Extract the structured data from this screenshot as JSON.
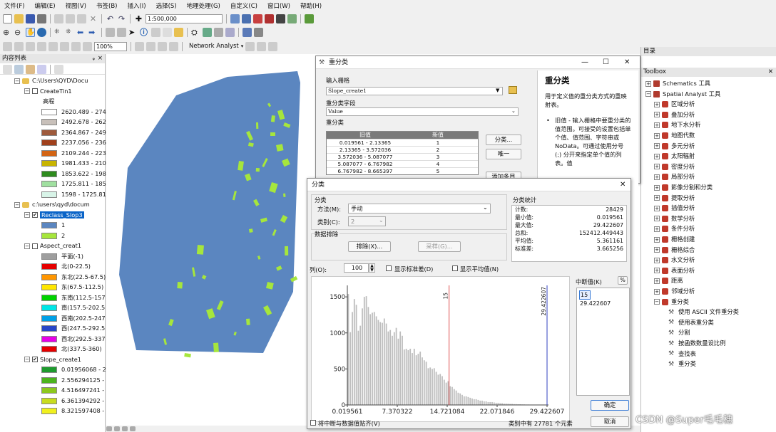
{
  "menu": [
    "文件(F)",
    "编辑(E)",
    "视图(V)",
    "书签(B)",
    "插入(I)",
    "选择(S)",
    "地理处理(G)",
    "自定义(C)",
    "窗口(W)",
    "帮助(H)"
  ],
  "toolbar": {
    "scale": "1:500,000",
    "zoom_pct": "100%",
    "network_analyst": "Network Analyst"
  },
  "toc": {
    "title": "内容列表",
    "pin": "ᵩ",
    "close": "×",
    "items": [
      {
        "type": "group",
        "label": "C:\\Users\\QYD\\Docu"
      },
      {
        "type": "layer",
        "label": "CreateTin1",
        "checked": false
      },
      {
        "type": "legend-head",
        "label": "高程"
      },
      {
        "type": "legend",
        "label": "2620.489 - 274",
        "color": "#fff"
      },
      {
        "type": "legend",
        "label": "2492.678 - 262",
        "color": "#c8c0ba"
      },
      {
        "type": "legend",
        "label": "2364.867 - 249",
        "color": "#9e5a3c"
      },
      {
        "type": "legend",
        "label": "2237.056 - 236",
        "color": "#a0401c"
      },
      {
        "type": "legend",
        "label": "2109.244 - 223",
        "color": "#d26414"
      },
      {
        "type": "legend",
        "label": "1981.433 - 210",
        "color": "#c8b400"
      },
      {
        "type": "legend",
        "label": "1853.622 - 198",
        "color": "#2e8c1e"
      },
      {
        "type": "legend",
        "label": "1725.811 - 185",
        "color": "#a0e0a0"
      },
      {
        "type": "legend",
        "label": "1598 - 1725.81",
        "color": "#d8f4e8"
      },
      {
        "type": "group",
        "label": "c:\\users\\qyd\\docum"
      },
      {
        "type": "layer",
        "label": "Reclass_Slop3",
        "checked": true,
        "selected": true
      },
      {
        "type": "legend",
        "label": "1",
        "color": "#5b86c0"
      },
      {
        "type": "legend",
        "label": "2",
        "color": "#a6e63c"
      },
      {
        "type": "layer",
        "label": "Aspect_creat1",
        "checked": false
      },
      {
        "type": "legend",
        "label": "平面(-1)",
        "color": "#9e9e9e"
      },
      {
        "type": "legend",
        "label": "北(0-22.5)",
        "color": "#e60000"
      },
      {
        "type": "legend",
        "label": "东北(22.5-67.5)",
        "color": "#ff9600"
      },
      {
        "type": "legend",
        "label": "东(67.5-112.5)",
        "color": "#ffe600"
      },
      {
        "type": "legend",
        "label": "东南(112.5-157",
        "color": "#00d200"
      },
      {
        "type": "legend",
        "label": "南(157.5-202.5",
        "color": "#00e6e6"
      },
      {
        "type": "legend",
        "label": "西南(202.5-247",
        "color": "#00a0e6"
      },
      {
        "type": "legend",
        "label": "西(247.5-292.5",
        "color": "#2846c8"
      },
      {
        "type": "legend",
        "label": "西北(292.5-337",
        "color": "#e600e6"
      },
      {
        "type": "legend",
        "label": "北(337.5-360)",
        "color": "#e60000"
      },
      {
        "type": "layer",
        "label": "Slope_create1",
        "checked": true
      },
      {
        "type": "legend",
        "label": "0.01956068 - 2",
        "color": "#1e9b2e"
      },
      {
        "type": "legend",
        "label": "2.556294125 -",
        "color": "#4cb41e"
      },
      {
        "type": "legend",
        "label": "4.516497241 -",
        "color": "#8cc81e"
      },
      {
        "type": "legend",
        "label": "6.361394292 -",
        "color": "#c8dc1e"
      },
      {
        "type": "legend",
        "label": "8.321597408 -",
        "color": "#f0f01e"
      }
    ]
  },
  "catalog": {
    "title": "目录",
    "toolbox_title": "Toolbox",
    "items": [
      {
        "label": "Schematics 工具",
        "indent": 0,
        "kind": "box"
      },
      {
        "label": "Spatial Analyst 工具",
        "indent": 0,
        "kind": "box"
      },
      {
        "label": "区域分析",
        "indent": 1,
        "kind": "set"
      },
      {
        "label": "叠加分析",
        "indent": 1,
        "kind": "set"
      },
      {
        "label": "地下水分析",
        "indent": 1,
        "kind": "set"
      },
      {
        "label": "地图代数",
        "indent": 1,
        "kind": "set"
      },
      {
        "label": "多元分析",
        "indent": 1,
        "kind": "set"
      },
      {
        "label": "太阳辐射",
        "indent": 1,
        "kind": "set"
      },
      {
        "label": "密度分析",
        "indent": 1,
        "kind": "set"
      },
      {
        "label": "局部分析",
        "indent": 1,
        "kind": "set"
      },
      {
        "label": "影像分割和分类",
        "indent": 1,
        "kind": "set"
      },
      {
        "label": "提取分析",
        "indent": 1,
        "kind": "set"
      },
      {
        "label": "插值分析",
        "indent": 1,
        "kind": "set"
      },
      {
        "label": "数学分析",
        "indent": 1,
        "kind": "set"
      },
      {
        "label": "条件分析",
        "indent": 1,
        "kind": "set"
      },
      {
        "label": "栅格创建",
        "indent": 1,
        "kind": "set"
      },
      {
        "label": "栅格综合",
        "indent": 1,
        "kind": "set"
      },
      {
        "label": "水文分析",
        "indent": 1,
        "kind": "set"
      },
      {
        "label": "表面分析",
        "indent": 1,
        "kind": "set"
      },
      {
        "label": "距离",
        "indent": 1,
        "kind": "set"
      },
      {
        "label": "邻域分析",
        "indent": 1,
        "kind": "set"
      },
      {
        "label": "重分类",
        "indent": 1,
        "kind": "set",
        "open": true
      },
      {
        "label": "使用 ASCII 文件重分类",
        "indent": 2,
        "kind": "tool"
      },
      {
        "label": "使用表重分类",
        "indent": 2,
        "kind": "tool"
      },
      {
        "label": "分割",
        "indent": 2,
        "kind": "tool"
      },
      {
        "label": "按函数数量设比例",
        "indent": 2,
        "kind": "tool"
      },
      {
        "label": "查找表",
        "indent": 2,
        "kind": "tool"
      },
      {
        "label": "重分类",
        "indent": 2,
        "kind": "tool"
      }
    ]
  },
  "reclass_dialog": {
    "title": "重分类",
    "input_raster_label": "输入栅格",
    "input_raster": "Slope_create1",
    "field_label": "重分类字段",
    "field": "Value",
    "reclass_label": "重分类",
    "col_old": "旧值",
    "col_new": "新值",
    "rows": [
      {
        "old": "0.019561 - 2.13365",
        "new": "1"
      },
      {
        "old": "2.13365 - 3.572036",
        "new": "2"
      },
      {
        "old": "3.572036 - 5.087077",
        "new": "3"
      },
      {
        "old": "5.087077 - 6.767982",
        "new": "4"
      },
      {
        "old": "6.767982 - 8.665397",
        "new": "5"
      }
    ],
    "btn_classify": "分类...",
    "btn_unique": "唯一",
    "btn_add": "添加条目",
    "help_title": "重分类",
    "help_body": "用于定义值的重分类方式的重映射表。",
    "help_bullet": "旧值 - 输入栅格中要重分类的值范围。可接受的设置包括单个值、值范围、字符串或 NoData。可通过使用分号 (;) 分开来指定单个值的列表。值"
  },
  "classify_dialog": {
    "title": "分类",
    "class_group": "分类",
    "method_label": "方法(M):",
    "method": "手动",
    "classes_label": "类别(C):",
    "classes": "2",
    "exclusion_group": "数据排除",
    "btn_exclude": "排除(X)...",
    "btn_sample": "采样(G)...",
    "stats_title": "分类统计",
    "stats": [
      {
        "k": "计数:",
        "v": "28429"
      },
      {
        "k": "最小值:",
        "v": "0.019561"
      },
      {
        "k": "最大值:",
        "v": "29.422607"
      },
      {
        "k": "总和:",
        "v": "152412.449443"
      },
      {
        "k": "平均值:",
        "v": "5.361161"
      },
      {
        "k": "标准差:",
        "v": "3.665256"
      }
    ],
    "columns_label": "列(O):",
    "columns": "100",
    "show_std": "显示标准差(D)",
    "show_mean": "显示平均值(N)",
    "y_ticks": [
      "1500",
      "1000",
      "500",
      "0"
    ],
    "x_ticks": [
      "0.019561",
      "7.370322",
      "14.721084",
      "22.071846",
      "29.422607"
    ],
    "break_marker_1": "15",
    "break_marker_2": "29.422607",
    "breaks_label": "中断值(K)",
    "pct": "%",
    "breaks": [
      "15",
      "29.422607"
    ],
    "btn_ok": "确定",
    "btn_cancel": "取消",
    "snap_label": "将中断与数据值贴齐(V)",
    "elements_text": "类别中有 27781 个元素"
  },
  "histogram_counts": [
    1540,
    1010,
    1290,
    1470,
    1390,
    1030,
    1100,
    1340,
    1500,
    1510,
    1360,
    1260,
    1280,
    1290,
    1230,
    1180,
    1150,
    1140,
    1200,
    1130,
    1020,
    1040,
    960,
    1010,
    1070,
    920,
    1020,
    960,
    770,
    780,
    760,
    780,
    720,
    780,
    690,
    710,
    740,
    660,
    620,
    600,
    510,
    520,
    500,
    510,
    460,
    420,
    430,
    400,
    350,
    310,
    330,
    260,
    250,
    220,
    200,
    170,
    160,
    140,
    120,
    120,
    110,
    100,
    90,
    80,
    80,
    70,
    60,
    60,
    50,
    50,
    40,
    40,
    40,
    35,
    30,
    30,
    25,
    25,
    20,
    20,
    18,
    15,
    15,
    12,
    12,
    10,
    10,
    8,
    8,
    6,
    6,
    5,
    5,
    4,
    4,
    3,
    3,
    3,
    2,
    2
  ],
  "histogram_max": 1600,
  "watermark": "CSDN @Super毛毛穗"
}
